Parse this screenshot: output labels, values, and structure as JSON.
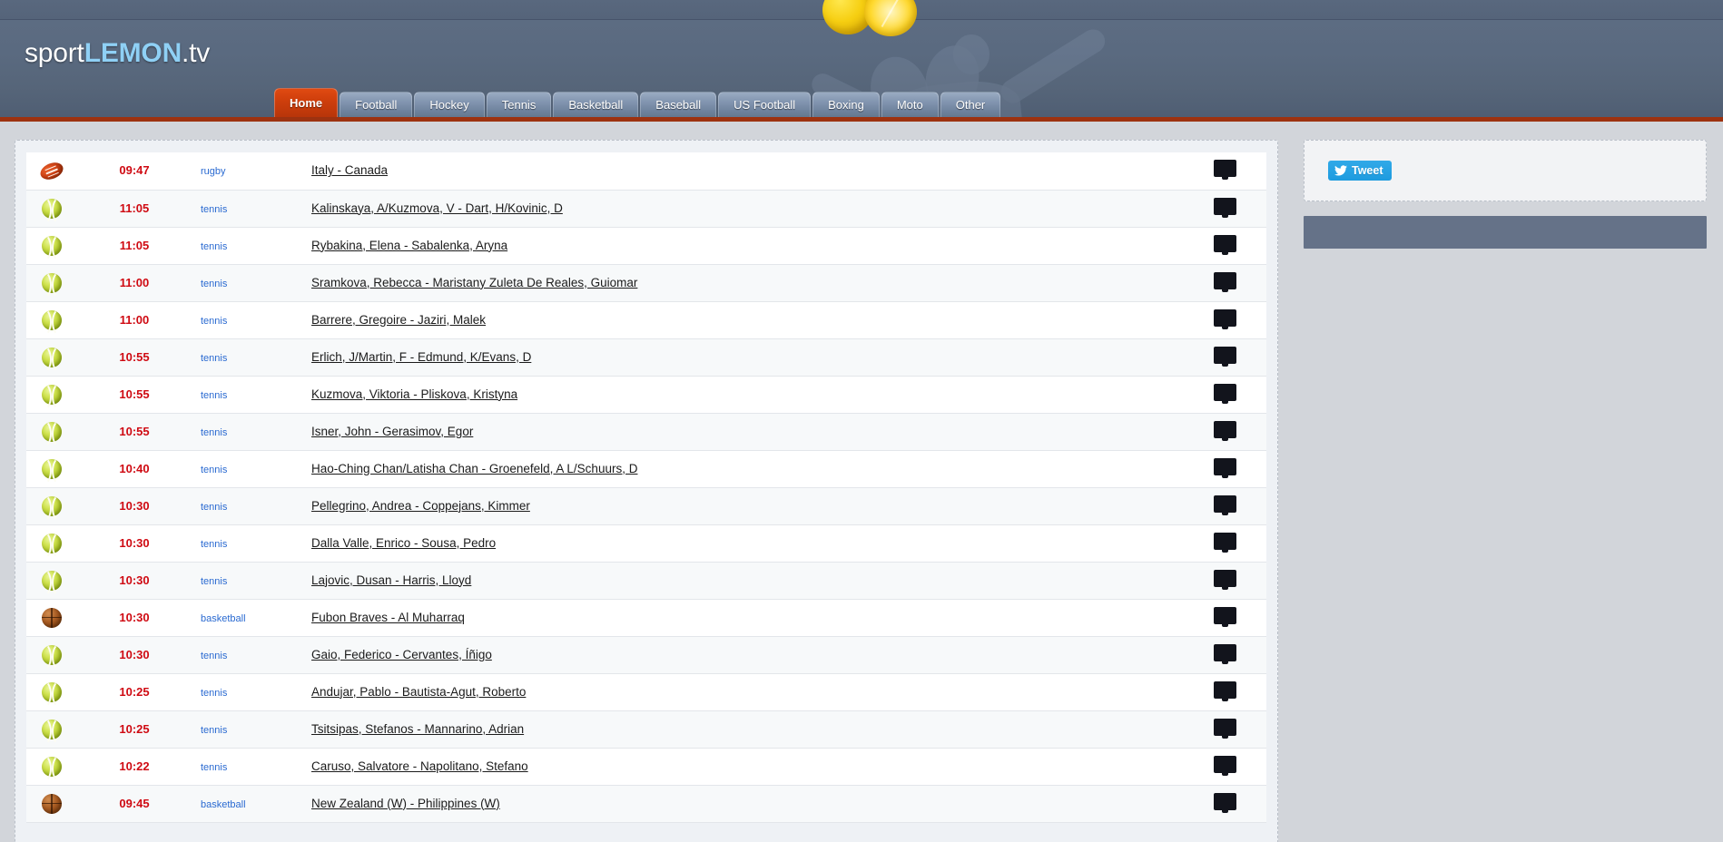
{
  "site": {
    "logo_prefix": "sport",
    "logo_brand": "LEMON",
    "logo_suffix": ".tv",
    "accent_red": "#cf3f0c",
    "accent_blue": "#8fd0f5",
    "time_color": "#cf0a12",
    "sport_link_color": "#2a6ad1",
    "header_bg": "#5a6a80",
    "page_bg": "#d2d5da"
  },
  "nav": {
    "tabs": [
      {
        "label": "Home",
        "active": true
      },
      {
        "label": "Football",
        "active": false
      },
      {
        "label": "Hockey",
        "active": false
      },
      {
        "label": "Tennis",
        "active": false
      },
      {
        "label": "Basketball",
        "active": false
      },
      {
        "label": "Baseball",
        "active": false
      },
      {
        "label": "US Football",
        "active": false
      },
      {
        "label": "Boxing",
        "active": false
      },
      {
        "label": "Moto",
        "active": false
      },
      {
        "label": "Other",
        "active": false
      }
    ]
  },
  "decor": {
    "lemon_whole": "lemon-whole-icon",
    "lemon_half": "lemon-half-icon",
    "header_photo": "sports-photo-watermark"
  },
  "events": [
    {
      "icon": "rugby-ball-icon",
      "sport_type": "rugby",
      "time": "09:47",
      "sport": "rugby",
      "match": "Italy - Canada",
      "tv": "tv-icon"
    },
    {
      "icon": "tennis-ball-icon",
      "sport_type": "tennis",
      "time": "11:05",
      "sport": "tennis",
      "match": "Kalinskaya, A/Kuzmova, V - Dart, H/Kovinic, D",
      "tv": "tv-icon"
    },
    {
      "icon": "tennis-ball-icon",
      "sport_type": "tennis",
      "time": "11:05",
      "sport": "tennis",
      "match": "Rybakina, Elena - Sabalenka, Aryna",
      "tv": "tv-icon"
    },
    {
      "icon": "tennis-ball-icon",
      "sport_type": "tennis",
      "time": "11:00",
      "sport": "tennis",
      "match": "Sramkova, Rebecca - Maristany Zuleta De Reales, Guiomar",
      "tv": "tv-icon"
    },
    {
      "icon": "tennis-ball-icon",
      "sport_type": "tennis",
      "time": "11:00",
      "sport": "tennis",
      "match": "Barrere, Gregoire - Jaziri, Malek",
      "tv": "tv-icon"
    },
    {
      "icon": "tennis-ball-icon",
      "sport_type": "tennis",
      "time": "10:55",
      "sport": "tennis",
      "match": "Erlich, J/Martin, F - Edmund, K/Evans, D",
      "tv": "tv-icon"
    },
    {
      "icon": "tennis-ball-icon",
      "sport_type": "tennis",
      "time": "10:55",
      "sport": "tennis",
      "match": "Kuzmova, Viktoria - Pliskova, Kristyna",
      "tv": "tv-icon"
    },
    {
      "icon": "tennis-ball-icon",
      "sport_type": "tennis",
      "time": "10:55",
      "sport": "tennis",
      "match": "Isner, John - Gerasimov, Egor",
      "tv": "tv-icon"
    },
    {
      "icon": "tennis-ball-icon",
      "sport_type": "tennis",
      "time": "10:40",
      "sport": "tennis",
      "match": "Hao-Ching Chan/Latisha Chan - Groenefeld, A L/Schuurs, D",
      "tv": "tv-icon"
    },
    {
      "icon": "tennis-ball-icon",
      "sport_type": "tennis",
      "time": "10:30",
      "sport": "tennis",
      "match": "Pellegrino, Andrea - Coppejans, Kimmer",
      "tv": "tv-icon"
    },
    {
      "icon": "tennis-ball-icon",
      "sport_type": "tennis",
      "time": "10:30",
      "sport": "tennis",
      "match": "Dalla Valle, Enrico - Sousa, Pedro",
      "tv": "tv-icon"
    },
    {
      "icon": "tennis-ball-icon",
      "sport_type": "tennis",
      "time": "10:30",
      "sport": "tennis",
      "match": "Lajovic, Dusan - Harris, Lloyd",
      "tv": "tv-icon"
    },
    {
      "icon": "basketball-icon",
      "sport_type": "basketball",
      "time": "10:30",
      "sport": "basketball",
      "match": "Fubon Braves - Al Muharraq",
      "tv": "tv-icon"
    },
    {
      "icon": "tennis-ball-icon",
      "sport_type": "tennis",
      "time": "10:30",
      "sport": "tennis",
      "match": "Gaio, Federico - Cervantes, Íñigo",
      "tv": "tv-icon"
    },
    {
      "icon": "tennis-ball-icon",
      "sport_type": "tennis",
      "time": "10:25",
      "sport": "tennis",
      "match": "Andujar, Pablo - Bautista-Agut, Roberto",
      "tv": "tv-icon"
    },
    {
      "icon": "tennis-ball-icon",
      "sport_type": "tennis",
      "time": "10:25",
      "sport": "tennis",
      "match": "Tsitsipas, Stefanos - Mannarino, Adrian",
      "tv": "tv-icon"
    },
    {
      "icon": "tennis-ball-icon",
      "sport_type": "tennis",
      "time": "10:22",
      "sport": "tennis",
      "match": "Caruso, Salvatore - Napolitano, Stefano",
      "tv": "tv-icon"
    },
    {
      "icon": "basketball-icon",
      "sport_type": "basketball",
      "time": "09:45",
      "sport": "basketball",
      "match": "New Zealand (W) - Philippines (W)",
      "tv": "tv-icon"
    }
  ],
  "sidebar": {
    "tweet_label": "Tweet",
    "tweet_icon": "twitter-bird-icon",
    "ad_placeholder": ""
  }
}
